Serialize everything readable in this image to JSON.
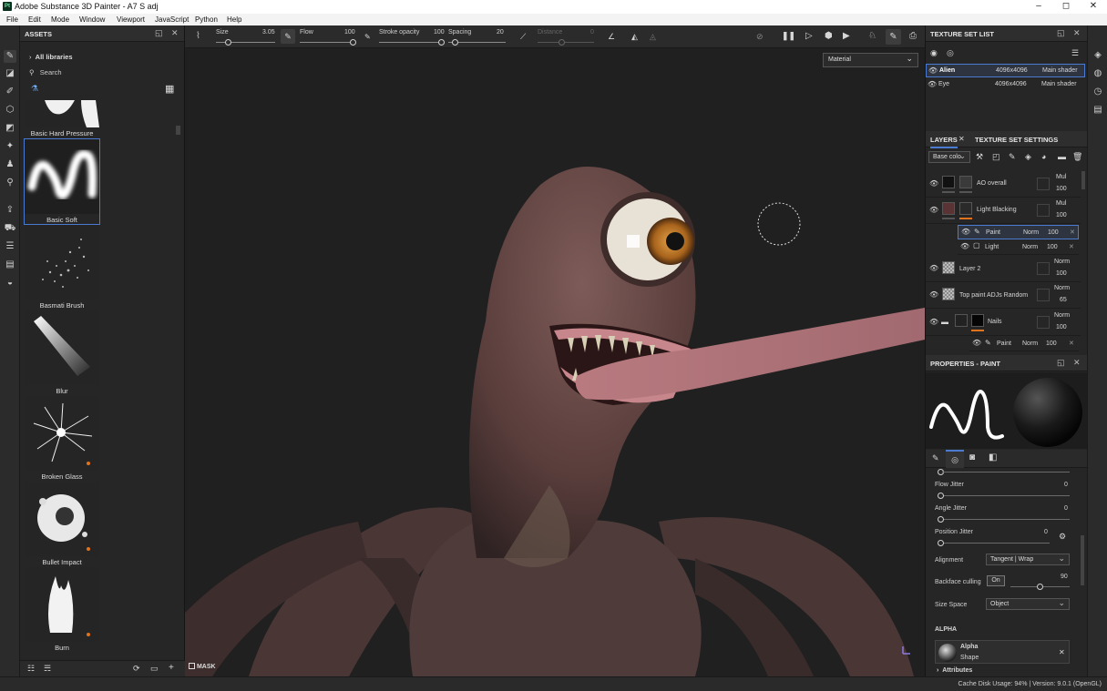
{
  "window": {
    "title": "Adobe Substance 3D Painter - A7 S adj",
    "logo": "Pt",
    "controls": [
      "–",
      "◻",
      "✕"
    ]
  },
  "menu": [
    "File",
    "Edit",
    "Mode",
    "Window",
    "Viewport",
    "JavaScript",
    "Python",
    "Help"
  ],
  "assets": {
    "title": "ASSETS",
    "library": "All libraries",
    "search_placeholder": "Search",
    "brushes": [
      {
        "name": "Basic Hard Pressure"
      },
      {
        "name": "Basic Soft",
        "selected": true
      },
      {
        "name": "Basmati Brush"
      },
      {
        "name": "Blur"
      },
      {
        "name": "Broken Glass"
      },
      {
        "name": "Bullet Impact"
      },
      {
        "name": "Burn"
      }
    ]
  },
  "toolbar": {
    "size_label": "Size",
    "size_value": "3.05",
    "flow_label": "Flow",
    "flow_value": "100",
    "stroke_opacity_label": "Stroke opacity",
    "stroke_opacity_value": "100",
    "spacing_label": "Spacing",
    "spacing_value": "20",
    "distance_label": "Distance",
    "distance_value": "0"
  },
  "viewport": {
    "mode_select": "Material",
    "mask_label": "MASK"
  },
  "texture_set_list": {
    "title": "TEXTURE SET LIST",
    "sets": [
      {
        "name": "Alien",
        "res": "4096x4096",
        "shader": "Main shader"
      },
      {
        "name": "Eye",
        "res": "4096x4096",
        "shader": "Main shader"
      }
    ]
  },
  "layers": {
    "tab_layers": "LAYERS",
    "tab_settings": "TEXTURE SET SETTINGS",
    "channel": "Base colo",
    "items": [
      {
        "name": "AO overall",
        "blend": "Mul",
        "opacity": "100"
      },
      {
        "name": "Light Blacking",
        "blend": "Mul",
        "opacity": "100"
      },
      {
        "name": "Paint",
        "blend": "Norm",
        "opacity": "100"
      },
      {
        "name": "Light",
        "blend": "Norm",
        "opacity": "100"
      },
      {
        "name": "Layer 2",
        "blend": "Norm",
        "opacity": "100"
      },
      {
        "name": "Top paint ADJs Random",
        "blend": "Norm",
        "opacity": "65"
      },
      {
        "name": "Nails",
        "blend": "Norm",
        "opacity": "100"
      },
      {
        "name": "Paint",
        "blend": "Norm",
        "opacity": "100"
      }
    ]
  },
  "properties": {
    "title": "PROPERTIES - PAINT",
    "flow_jitter_label": "Flow Jitter",
    "flow_jitter_value": "0",
    "angle_jitter_label": "Angle Jitter",
    "angle_jitter_value": "0",
    "position_jitter_label": "Position Jitter",
    "position_jitter_value": "0",
    "alignment_label": "Alignment",
    "alignment_value": "Tangent | Wrap",
    "backface_label": "Backface culling",
    "backface_toggle": "On",
    "backface_value": "90",
    "size_space_label": "Size Space",
    "size_space_value": "Object",
    "alpha_header": "ALPHA",
    "alpha_name": "Alpha",
    "alpha_sub": "Shape",
    "attributes_label": "Attributes"
  },
  "status": {
    "text": "Cache Disk Usage:   94%  |  Version: 9.0.1 (OpenGL)"
  },
  "colors": {
    "accent": "#e0731c",
    "selection": "#4a7bd0"
  }
}
